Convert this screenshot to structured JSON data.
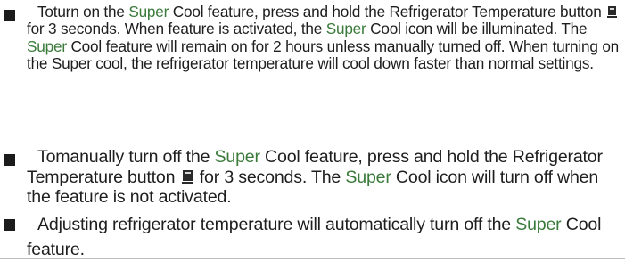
{
  "items": [
    {
      "s1": "Toturn on the ",
      "s2": "Super",
      "s3": " Cool feature, press and hold the Refrigerator Temperature button ",
      "s4": " for 3 seconds. When feature is activated, the ",
      "s5": "Super",
      "s6": " Cool icon will be illuminated. The ",
      "s7": "Super",
      "s8": " Cool feature will remain on for 2 hours unless manually turned off. When turning on the Super cool, the refrigerator temperature will cool down faster than normal settings."
    },
    {
      "s1": "Tomanually turn off the ",
      "s2": "Super",
      "s3": " Cool feature, press and hold the Refrigerator Temperature button ",
      "s4": " for 3 seconds. The ",
      "s5": "Super",
      "s6": " Cool icon will turn off when the feature is not activated."
    },
    {
      "s1": "Adjusting refrigerator temperature will automatically turn off the ",
      "s2": "Super",
      "s3": " Cool feature."
    }
  ],
  "icons": {
    "button_icon": "refrigerator-temperature-button-icon",
    "bullet": "square-bullet"
  },
  "colors": {
    "text": "#1e1e1e",
    "highlight": "#3a7a3a"
  }
}
